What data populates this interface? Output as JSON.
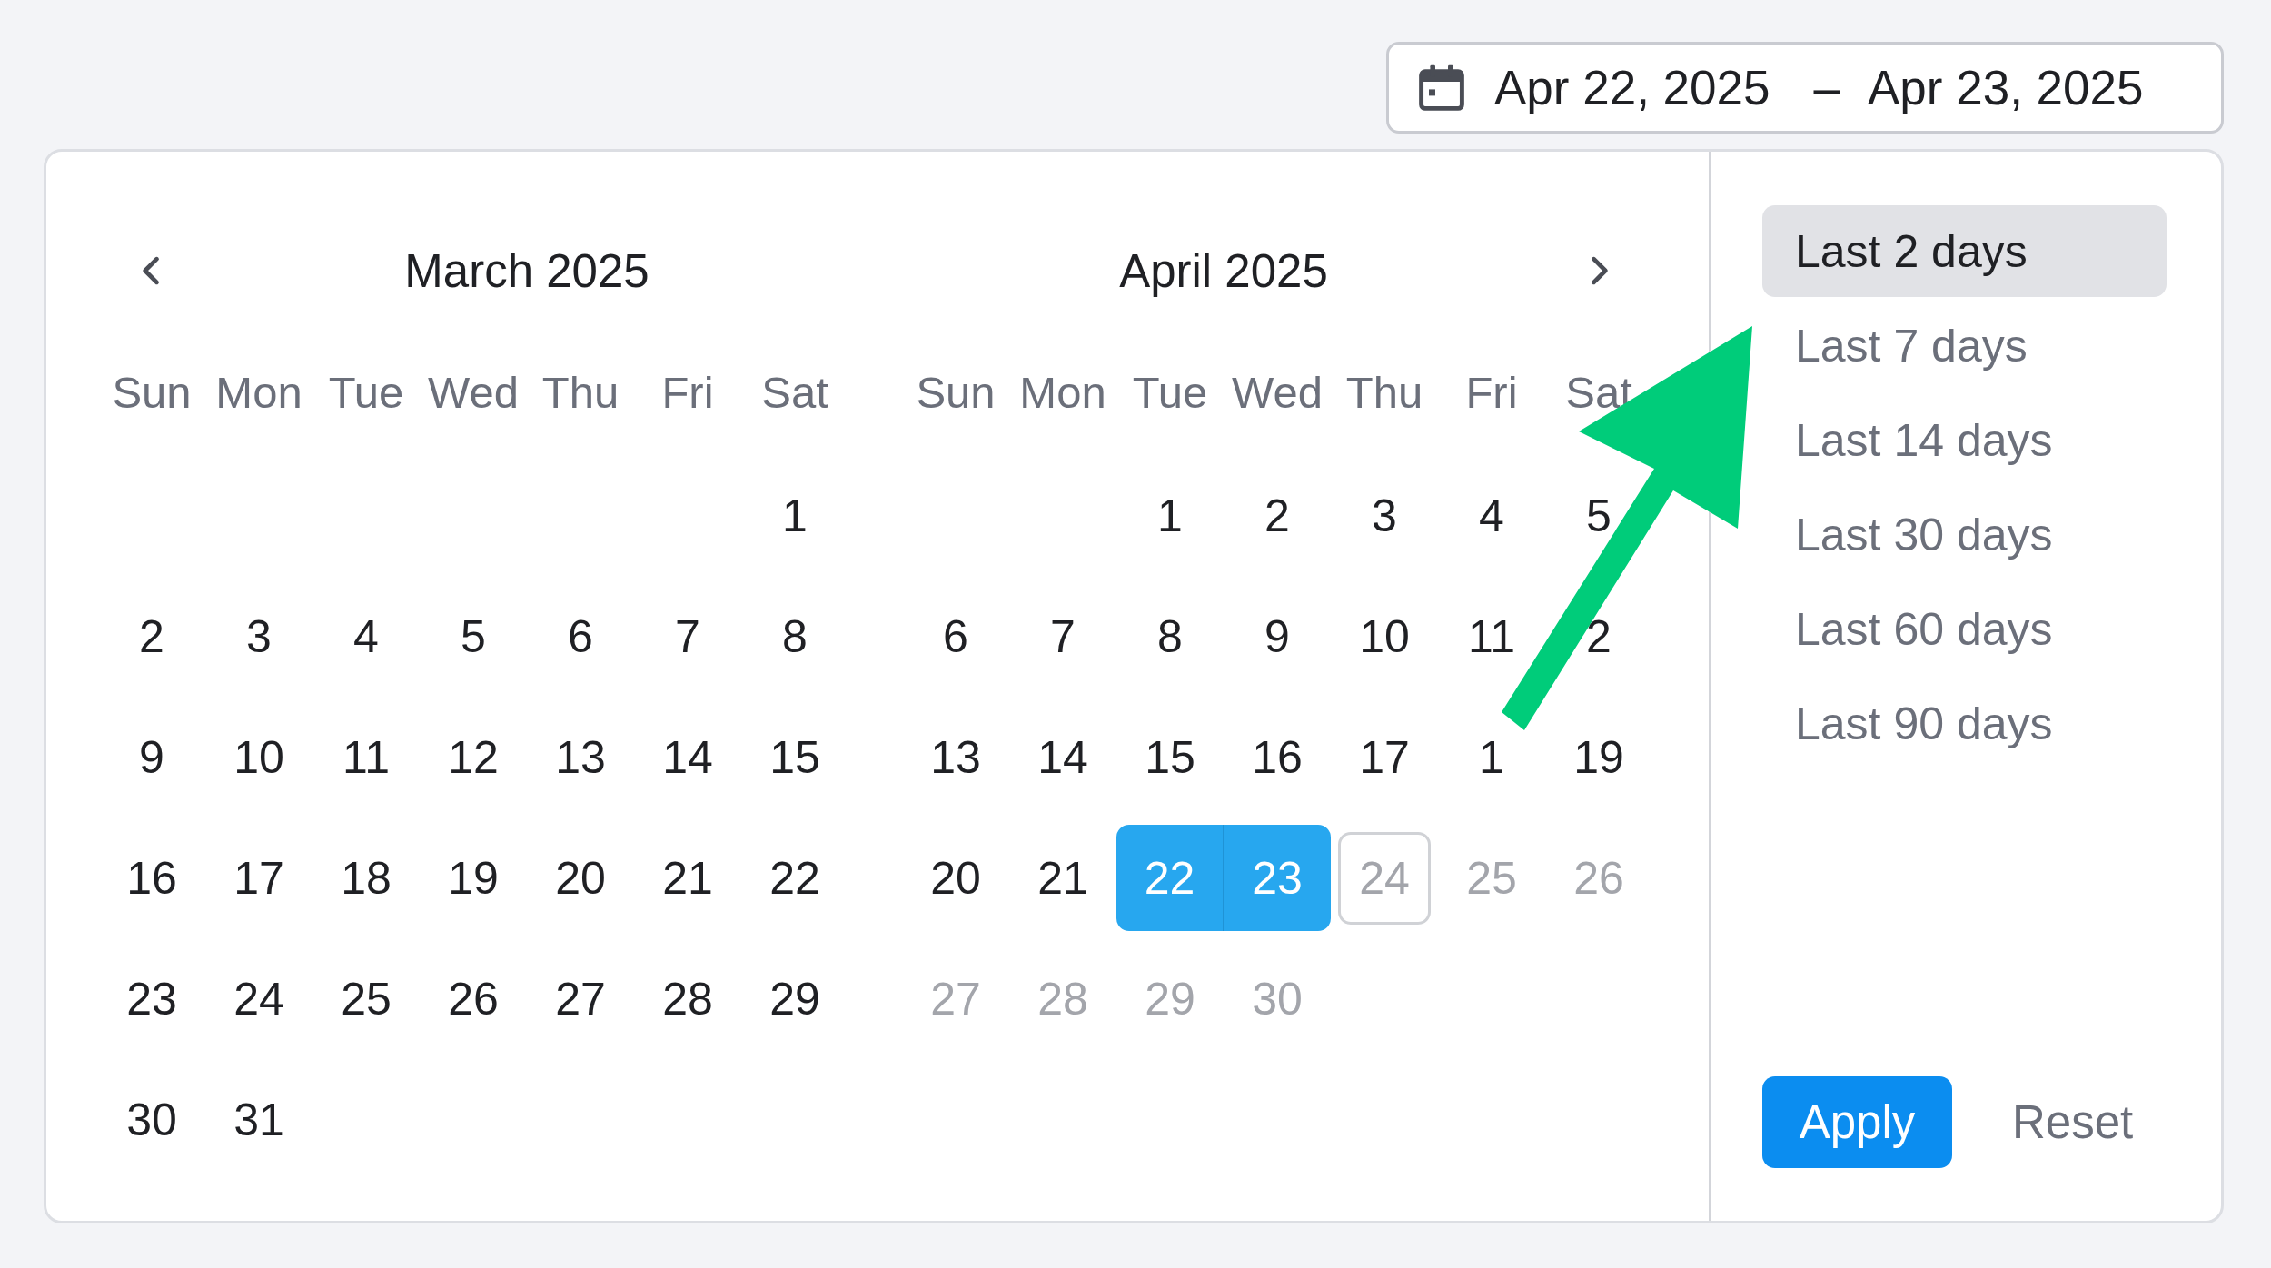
{
  "date_range": {
    "start": "Apr 22, 2025",
    "separator": "–",
    "end": "Apr 23, 2025"
  },
  "months": [
    {
      "title": "March 2025",
      "kind": "with_prev",
      "weekdays": [
        "Sun",
        "Mon",
        "Tue",
        "Wed",
        "Thu",
        "Fri",
        "Sat"
      ],
      "weeks": [
        [
          {
            "label": "1",
            "selected": false,
            "today": false,
            "disabled": false
          }
        ],
        [
          {
            "label": "2",
            "selected": false,
            "today": false,
            "disabled": false
          },
          {
            "label": "3",
            "selected": false,
            "today": false,
            "disabled": false
          },
          {
            "label": "4",
            "selected": false,
            "today": false,
            "disabled": false
          },
          {
            "label": "5",
            "selected": false,
            "today": false,
            "disabled": false
          },
          {
            "label": "6",
            "selected": false,
            "today": false,
            "disabled": false
          },
          {
            "label": "7",
            "selected": false,
            "today": false,
            "disabled": false
          },
          {
            "label": "8",
            "selected": false,
            "today": false,
            "disabled": false
          }
        ],
        [
          {
            "label": "9",
            "selected": false,
            "today": false,
            "disabled": false
          },
          {
            "label": "10",
            "selected": false,
            "today": false,
            "disabled": false
          },
          {
            "label": "11",
            "selected": false,
            "today": false,
            "disabled": false
          },
          {
            "label": "12",
            "selected": false,
            "today": false,
            "disabled": false
          },
          {
            "label": "13",
            "selected": false,
            "today": false,
            "disabled": false
          },
          {
            "label": "14",
            "selected": false,
            "today": false,
            "disabled": false
          },
          {
            "label": "15",
            "selected": false,
            "today": false,
            "disabled": false
          }
        ],
        [
          {
            "label": "16",
            "selected": false,
            "today": false,
            "disabled": false
          },
          {
            "label": "17",
            "selected": false,
            "today": false,
            "disabled": false
          },
          {
            "label": "18",
            "selected": false,
            "today": false,
            "disabled": false
          },
          {
            "label": "19",
            "selected": false,
            "today": false,
            "disabled": false
          },
          {
            "label": "20",
            "selected": false,
            "today": false,
            "disabled": false
          },
          {
            "label": "21",
            "selected": false,
            "today": false,
            "disabled": false
          },
          {
            "label": "22",
            "selected": false,
            "today": false,
            "disabled": false
          }
        ],
        [
          {
            "label": "23",
            "selected": false,
            "today": false,
            "disabled": false
          },
          {
            "label": "24",
            "selected": false,
            "today": false,
            "disabled": false
          },
          {
            "label": "25",
            "selected": false,
            "today": false,
            "disabled": false
          },
          {
            "label": "26",
            "selected": false,
            "today": false,
            "disabled": false
          },
          {
            "label": "27",
            "selected": false,
            "today": false,
            "disabled": false
          },
          {
            "label": "28",
            "selected": false,
            "today": false,
            "disabled": false
          },
          {
            "label": "29",
            "selected": false,
            "today": false,
            "disabled": false
          }
        ],
        [
          {
            "label": "30",
            "selected": false,
            "today": false,
            "disabled": false
          },
          {
            "label": "31",
            "selected": false,
            "today": false,
            "disabled": false
          }
        ]
      ]
    },
    {
      "title": "April 2025",
      "kind": "with_next",
      "weekdays": [
        "Sun",
        "Mon",
        "Tue",
        "Wed",
        "Thu",
        "Fri",
        "Sat"
      ],
      "weeks": [
        [
          {
            "label": "1",
            "selected": false,
            "today": false,
            "disabled": false
          },
          {
            "label": "2",
            "selected": false,
            "today": false,
            "disabled": false
          },
          {
            "label": "3",
            "selected": false,
            "today": false,
            "disabled": false
          },
          {
            "label": "4",
            "selected": false,
            "today": false,
            "disabled": false
          },
          {
            "label": "5",
            "selected": false,
            "today": false,
            "disabled": false
          }
        ],
        [
          {
            "label": "6",
            "selected": false,
            "today": false,
            "disabled": false
          },
          {
            "label": "7",
            "selected": false,
            "today": false,
            "disabled": false
          },
          {
            "label": "8",
            "selected": false,
            "today": false,
            "disabled": false
          },
          {
            "label": "9",
            "selected": false,
            "today": false,
            "disabled": false
          },
          {
            "label": "10",
            "selected": false,
            "today": false,
            "disabled": false
          },
          {
            "label": "11",
            "selected": false,
            "today": false,
            "disabled": false
          },
          {
            "label": "2",
            "selected": false,
            "today": false,
            "disabled": false
          }
        ],
        [
          {
            "label": "13",
            "selected": false,
            "today": false,
            "disabled": false
          },
          {
            "label": "14",
            "selected": false,
            "today": false,
            "disabled": false
          },
          {
            "label": "15",
            "selected": false,
            "today": false,
            "disabled": false
          },
          {
            "label": "16",
            "selected": false,
            "today": false,
            "disabled": false
          },
          {
            "label": "17",
            "selected": false,
            "today": false,
            "disabled": false
          },
          {
            "label": "1",
            "selected": false,
            "today": false,
            "disabled": false
          },
          {
            "label": "19",
            "selected": false,
            "today": false,
            "disabled": false
          }
        ],
        [
          {
            "label": "20",
            "selected": false,
            "today": false,
            "disabled": false
          },
          {
            "label": "21",
            "selected": false,
            "today": false,
            "disabled": false
          },
          {
            "label": "22",
            "selected": true,
            "today": false,
            "disabled": false
          },
          {
            "label": "23",
            "selected": true,
            "today": false,
            "disabled": false
          },
          {
            "label": "24",
            "selected": false,
            "today": true,
            "disabled": true
          },
          {
            "label": "25",
            "selected": false,
            "today": false,
            "disabled": true
          },
          {
            "label": "26",
            "selected": false,
            "today": false,
            "disabled": true
          }
        ],
        [
          {
            "label": "27",
            "selected": false,
            "today": false,
            "disabled": true
          },
          {
            "label": "28",
            "selected": false,
            "today": false,
            "disabled": true
          },
          {
            "label": "29",
            "selected": false,
            "today": false,
            "disabled": true
          },
          {
            "label": "30",
            "selected": false,
            "today": false,
            "disabled": true
          }
        ]
      ]
    }
  ],
  "presets": [
    {
      "label": "Last 2 days",
      "selected": true
    },
    {
      "label": "Last 7 days",
      "selected": false
    },
    {
      "label": "Last 14 days",
      "selected": false
    },
    {
      "label": "Last 30 days",
      "selected": false
    },
    {
      "label": "Last 60 days",
      "selected": false
    },
    {
      "label": "Last 90 days",
      "selected": false
    }
  ],
  "buttons": [
    {
      "label": "Apply",
      "kind": "primary"
    },
    {
      "label": "Reset",
      "kind": "text"
    }
  ]
}
